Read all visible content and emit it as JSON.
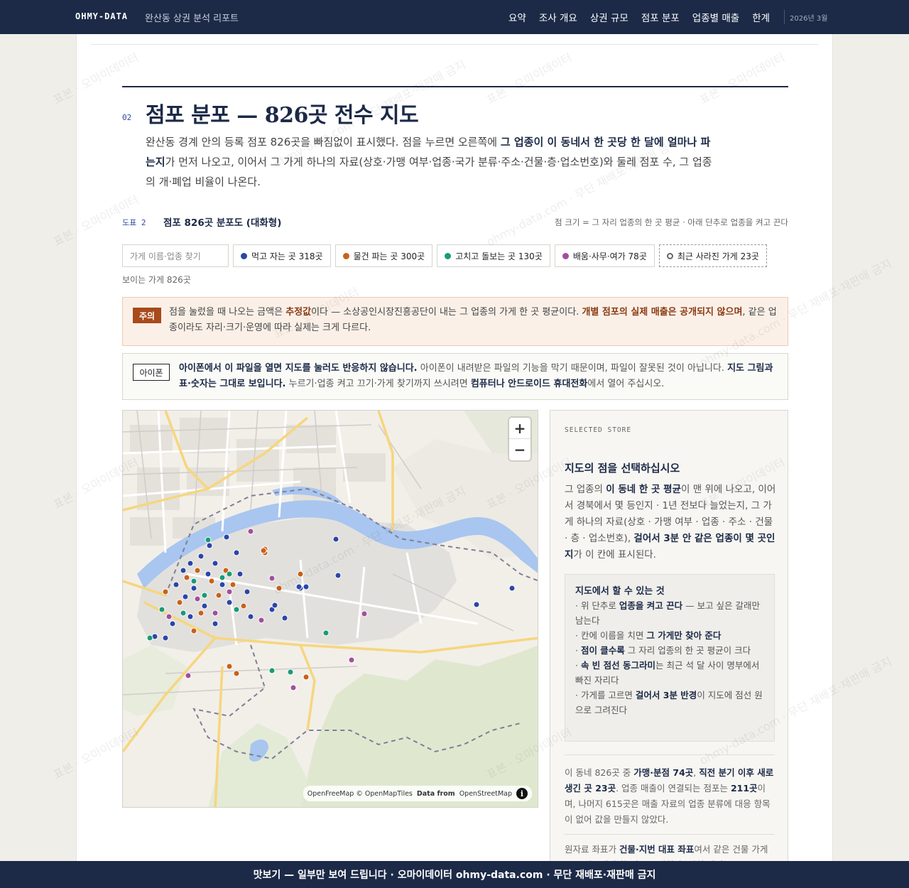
{
  "nav": {
    "brand": "OHMY-DATA",
    "report_title": "완산동 상권 분석 리포트",
    "links": [
      "요약",
      "조사 개요",
      "상권 규모",
      "점포 분포",
      "업종별 매출",
      "한계"
    ],
    "date": "2026년 3월"
  },
  "section": {
    "number": "02",
    "title": "점포 분포 — 826곳 전수 지도",
    "intro_1": "완산동 경계 안의 등록 점포 826곳을 빠짐없이 표시했다. 점을 누르면 오른쪽에 ",
    "intro_bold": "그 업종이 이 동네서 한 곳당 한 달에 얼마나 파는지",
    "intro_2": "가 먼저 나오고, 이어서 그 가게 하나의 자료(상호·가맹 여부·업종·국가 분류·주소·건물·층·업소번호)와 둘레 점포 수, 그 업종의 개·폐업 비율이 나온다."
  },
  "figure": {
    "label": "도표 2",
    "title": "점포 826곳 분포도 (대화형)",
    "note": "점 크기 = 그 자리 업종의 한 곳 평균 · 아래 단추로 업종을 켜고 끈다"
  },
  "controls": {
    "search_placeholder": "가게 이름·업종 찾기",
    "chips": [
      {
        "label": "먹고 자는 곳 318곳",
        "color": "#2b46a8"
      },
      {
        "label": "물건 파는 곳 300곳",
        "color": "#c8621a"
      },
      {
        "label": "고치고 돌보는 곳 130곳",
        "color": "#1a9a78"
      },
      {
        "label": "배움·사무·여가 78곳",
        "color": "#a24f9c"
      }
    ],
    "closed_chip": "최근 사라진 가게 23곳",
    "visible_count": "보이는 가게 826곳"
  },
  "caution": {
    "tag": "주의",
    "t1": "점을 눌렀을 때 나오는 금액은 ",
    "b1": "추정값",
    "t2": "이다 — 소상공인시장진흥공단이 내는 그 업종의 가게 한 곳 평균이다. ",
    "b2": "개별 점포의 실제 매출은 공개되지 않으며",
    "t3": ", 같은 업종이라도 자리·크기·운영에 따라 실제는 크게 다르다."
  },
  "iphone": {
    "tag": "아이폰",
    "b1": "아이폰에서 이 파일을 열면 지도를 눌러도 반응하지 않습니다.",
    "t1": " 아이폰이 내려받은 파일의 기능을 막기 때문이며, 파일이 잘못된 것이 아닙니다. ",
    "b2": "지도 그림과 표·숫자는 그대로 보입니다.",
    "t2": " 누르기·업종 켜고 끄기·가게 찾기까지 쓰시려면 ",
    "b3": "컴퓨터나 안드로이드 휴대전화",
    "t3": "에서 열어 주십시오."
  },
  "map": {
    "attribution_1": "OpenFreeMap © OpenMapTiles",
    "attribution_bold": "Data from",
    "attribution_2": "OpenStreetMap",
    "info": "i",
    "zoom_in": "+",
    "zoom_out": "−"
  },
  "side": {
    "eyebrow": "SELECTED STORE",
    "title": "지도의 점을 선택하십시오",
    "d1": "그 업종의 ",
    "db1": "이 동네 한 곳 평균",
    "d2": "이 맨 위에 나오고, 이어서 경북에서 몇 등인지 · 1년 전보다 늘었는지, 그 가게 하나의 자료(상호 · 가맹 여부 · 업종 · 주소 · 건물 · 층 · 업소번호), ",
    "db2": "걸어서 3분 안 같은 업종이 몇 곳인지",
    "d3": "가 이 칸에 표시된다.",
    "howto_title": "지도에서 할 수 있는 것",
    "h1a": "· 위 단추로 ",
    "h1b": "업종을 켜고 끈다",
    "h1c": " — 보고 싶은 갈래만 남는다",
    "h2a": "· 칸에 이름을 치면 ",
    "h2b": "그 가게만 찾아 준다",
    "h3a": "· ",
    "h3b": "점이 클수록",
    "h3c": " 그 자리 업종의 한 곳 평균이 크다",
    "h4a": "· ",
    "h4b": "속 빈 점선 동그라미",
    "h4c": "는 최근 석 달 사이 명부에서 빠진 자리다",
    "h5a": "· 가게를 고르면 ",
    "h5b": "걸어서 3분 반경",
    "h5c": "이 지도에 점선 원으로 그려진다",
    "s1": "이 동네 826곳 중 ",
    "sb1": "가맹·분점 74곳",
    "s2": ", ",
    "sb2": "직전 분기 이후 새로 생긴 곳 23곳",
    "s3": ". 업종 매출이 연결되는 점포는 ",
    "sb3": "211곳",
    "s4": "이며, 나머지 615곳은 매출 자료의 업종 분류에 대응 항목이 없어 값을 만들지 않았다.",
    "s5": "원자료 좌표가 ",
    "sb4": "건물·지번 대표 좌표",
    "s6": "여서 같은 건물 가게들은 지도에서 한 점으로 겹친다. 겹친 자리는"
  },
  "watermark": {
    "text_a": "표본 · 오마이데이터",
    "text_b": "ohmy-data.com · 무단 재배포·재판매 금지"
  },
  "footer": {
    "text": "맛보기 — 일부만 보여 드립니다 · 오마이데이터 ohmy-data.com · 무단 재배포·재판매 금지"
  }
}
